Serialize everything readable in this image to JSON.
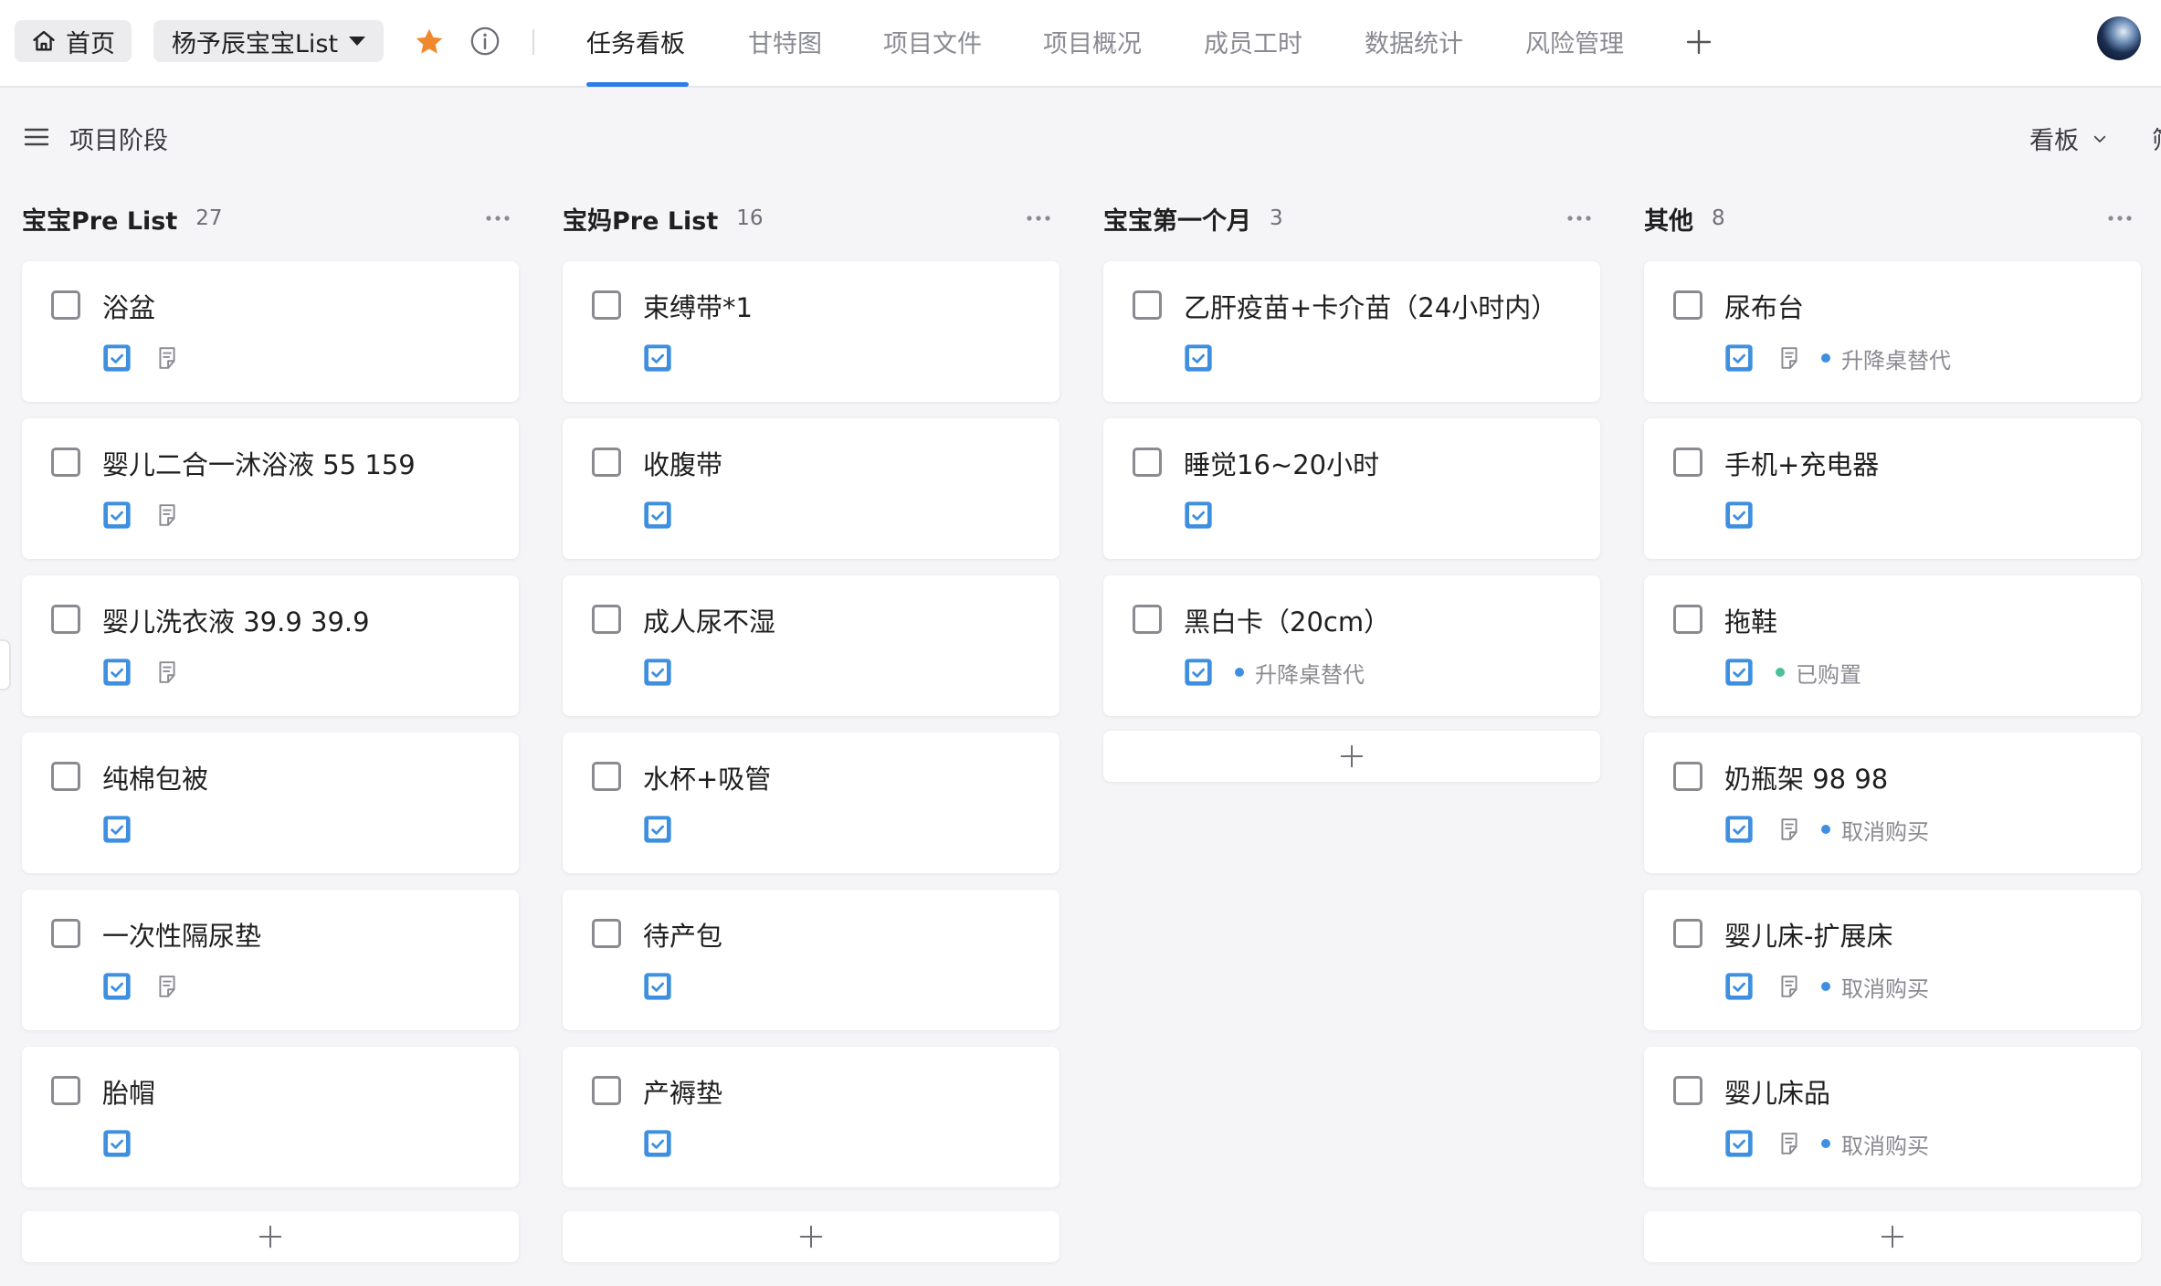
{
  "topbar": {
    "home_label": "首页",
    "project_name": "杨予辰宝宝List",
    "tabs": [
      {
        "label": "任务看板",
        "active": true
      },
      {
        "label": "甘特图",
        "active": false
      },
      {
        "label": "项目文件",
        "active": false
      },
      {
        "label": "项目概况",
        "active": false
      },
      {
        "label": "成员工时",
        "active": false
      },
      {
        "label": "数据统计",
        "active": false
      },
      {
        "label": "风险管理",
        "active": false
      }
    ],
    "accent_color": "#2d7be5",
    "star_color": "#f0892b"
  },
  "toolbar": {
    "stage_label": "项目阶段",
    "view_label": "看板"
  },
  "columns": [
    {
      "title": "宝宝Pre List",
      "count": "27",
      "cards": [
        {
          "title": "浴盆",
          "note": true,
          "tag": ""
        },
        {
          "title": "婴儿二合一沐浴液 55 159",
          "note": true,
          "tag": ""
        },
        {
          "title": "婴儿洗衣液 39.9 39.9",
          "note": true,
          "tag": ""
        },
        {
          "title": "纯棉包被",
          "note": false,
          "tag": ""
        },
        {
          "title": "一次性隔尿垫",
          "note": true,
          "tag": ""
        },
        {
          "title": "胎帽",
          "note": false,
          "tag": ""
        }
      ]
    },
    {
      "title": "宝妈Pre List",
      "count": "16",
      "cards": [
        {
          "title": "束缚带*1",
          "note": false,
          "tag": ""
        },
        {
          "title": "收腹带",
          "note": false,
          "tag": ""
        },
        {
          "title": "成人尿不湿",
          "note": false,
          "tag": ""
        },
        {
          "title": "水杯+吸管",
          "note": false,
          "tag": ""
        },
        {
          "title": "待产包",
          "note": false,
          "tag": ""
        },
        {
          "title": "产褥垫",
          "note": false,
          "tag": ""
        }
      ]
    },
    {
      "title": "宝宝第一个月",
      "count": "3",
      "cards": [
        {
          "title": "乙肝疫苗+卡介苗（24小时内）",
          "note": false,
          "tag": ""
        },
        {
          "title": "睡觉16~20小时",
          "note": false,
          "tag": ""
        },
        {
          "title": "黑白卡（20cm）",
          "note": false,
          "tag": "升降桌替代",
          "tag_color": "#3f8fe0"
        }
      ]
    },
    {
      "title": "其他",
      "count": "8",
      "cards": [
        {
          "title": "尿布台",
          "note": true,
          "tag": "升降桌替代",
          "tag_color": "#3f8fe0"
        },
        {
          "title": "手机+充电器",
          "note": false,
          "tag": ""
        },
        {
          "title": "拖鞋",
          "note": false,
          "tag": "已购置",
          "tag_color": "#4dbf9a"
        },
        {
          "title": "奶瓶架 98 98",
          "note": true,
          "tag": "取消购买",
          "tag_color": "#3f8fe0"
        },
        {
          "title": "婴儿床-扩展床",
          "note": true,
          "tag": "取消购买",
          "tag_color": "#3f8fe0"
        },
        {
          "title": "婴儿床品",
          "note": true,
          "tag": "取消购买",
          "tag_color": "#3f8fe0"
        }
      ]
    }
  ]
}
